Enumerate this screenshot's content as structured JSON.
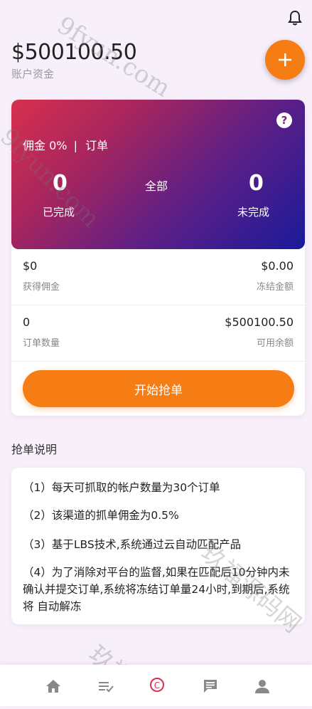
{
  "header": {
    "balance": "$500100.50",
    "balance_label": "账户资金"
  },
  "summary_card": {
    "commission_rate_label": "佣金 0%",
    "separator": "|",
    "orders_label": "订单",
    "completed_count": "0",
    "completed_label": "已完成",
    "all_label": "全部",
    "uncompleted_count": "0",
    "uncompleted_label": "未完成",
    "help_symbol": "?",
    "gradient_colors": [
      "#d8304e",
      "#5e1f86",
      "#1a1a9a"
    ]
  },
  "stats": [
    {
      "left_value": "$0",
      "left_label": "获得佣金",
      "right_value": "$0.00",
      "right_label": "冻结金额"
    },
    {
      "left_value": "0",
      "left_label": "订单数量",
      "right_value": "$500100.50",
      "right_label": "可用余额"
    }
  ],
  "start_button": "开始抢单",
  "rules_section": {
    "title": "抢单说明",
    "items": [
      "（1）每天可抓取的帐户数量为30个订单",
      "（2）该渠道的抓单佣金为0.5%",
      "（3）基于LBS技术,系统通过云自动匹配产品",
      "（4）为了消除对平台的监督,如果在匹配后10分钟内未确认并提交订单,系统将冻结订单量24小时,到期后,系统将 自动解冻"
    ]
  },
  "watermarks": [
    "9fyun.com",
    "9fyun.com",
    "玖福源码网",
    "玖福源"
  ],
  "bottom_nav": {
    "icons": [
      "home-icon",
      "order-list-icon",
      "grab-order-icon",
      "chat-icon",
      "profile-icon"
    ],
    "center_badge": "C"
  },
  "colors": {
    "accent": "#f67c14",
    "background": "#f7effa"
  }
}
